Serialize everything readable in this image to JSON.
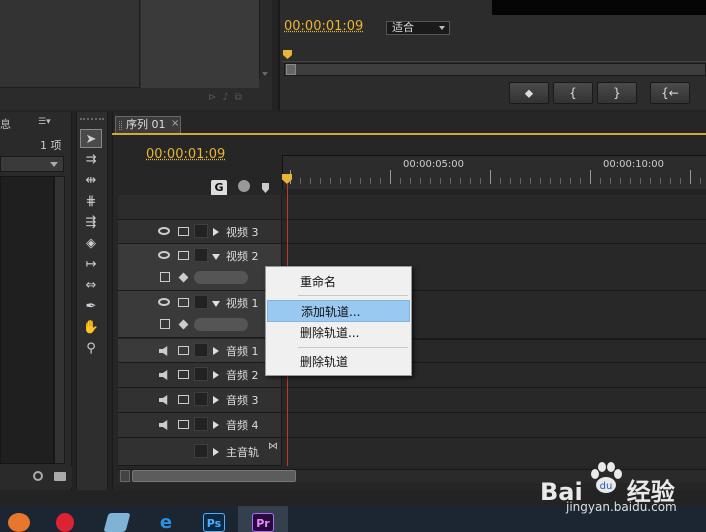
{
  "program_monitor": {
    "timecode": "00:00:01:09",
    "fit_option": "适合",
    "transport_buttons": [
      "⬥",
      "{",
      "}",
      "{←"
    ]
  },
  "project_panel": {
    "tab_label": "息",
    "item_count": "1 项",
    "menu_glyph": "☰▾"
  },
  "sequence": {
    "tab_label": "序列 01",
    "close_glyph": "×",
    "timecode": "00:00:01:09",
    "ruler_labels": [
      "00:00:05:00",
      "00:00:10:00"
    ]
  },
  "tracks": {
    "video": [
      {
        "name": "视频 3"
      },
      {
        "name": "视频 2"
      },
      {
        "name": "视频 1"
      }
    ],
    "audio": [
      {
        "name": "音频 1"
      },
      {
        "name": "音频 2"
      },
      {
        "name": "音频 3"
      },
      {
        "name": "音频 4"
      }
    ],
    "master": {
      "name": "主音轨"
    }
  },
  "context_menu": {
    "items": [
      "重命名",
      "添加轨道...",
      "删除轨道...",
      "删除轨道"
    ],
    "highlighted_index": 1
  },
  "taskbar": {
    "active_app": "Pr",
    "ps_label": "Ps"
  },
  "watermark": {
    "brand": "Bai",
    "brand_suffix": "经验",
    "url": "jingyan.baidu.com"
  },
  "colors": {
    "timecode": "#e8b534",
    "playhead_line": "#c0392b",
    "menu_highlight": "#99c9f0"
  }
}
